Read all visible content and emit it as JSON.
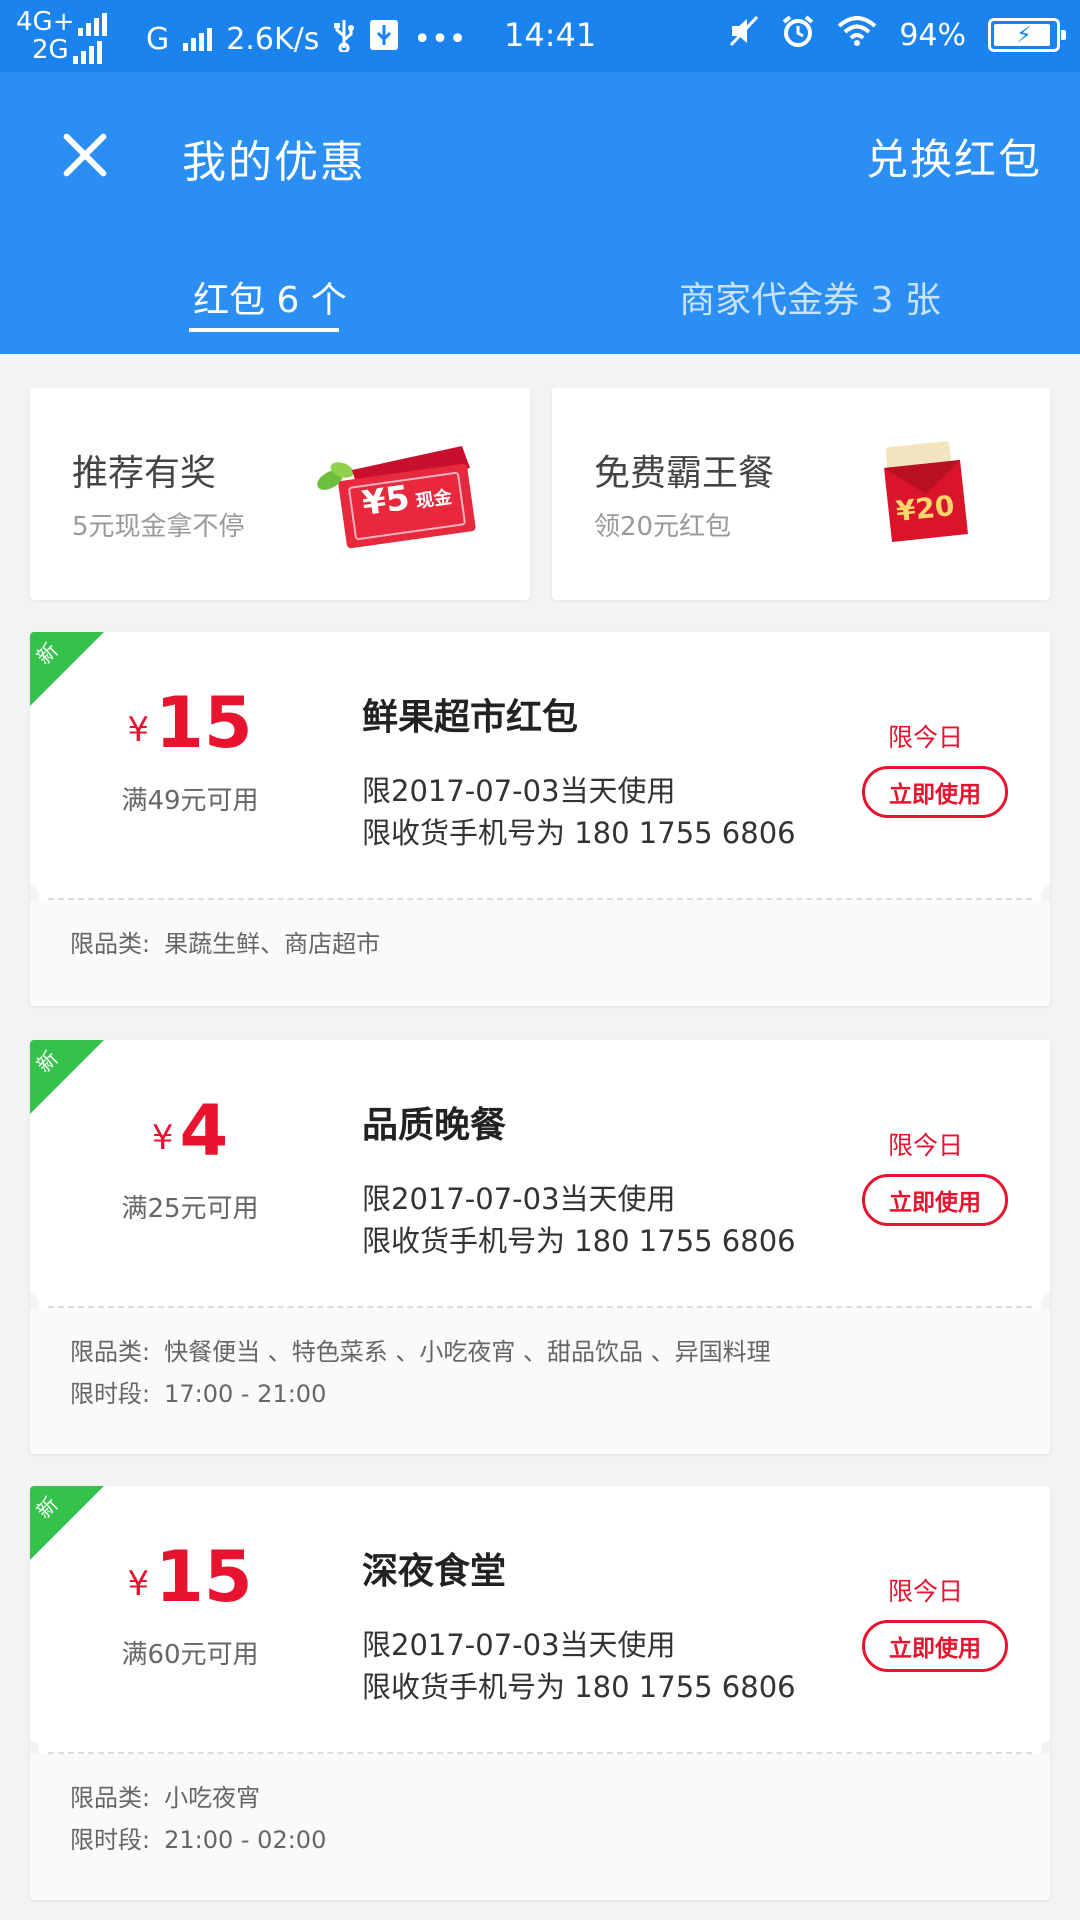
{
  "status_bar": {
    "net_top": "4G+",
    "net_bottom": "2G",
    "carrier": "G",
    "speed": "2.6K/s",
    "time": "14:41",
    "battery": "94%",
    "battery_level": 0.94
  },
  "header": {
    "title": "我的优惠",
    "exchange": "兑换红包"
  },
  "tabs": [
    {
      "label": "红包 6 个",
      "active": true
    },
    {
      "label": "商家代金券 3 张",
      "active": false
    }
  ],
  "promos": [
    {
      "title": "推荐有奖",
      "subtitle": "5元现金拿不停",
      "badge": "¥5",
      "badge_suffix": "现金"
    },
    {
      "title": "免费霸王餐",
      "subtitle": "领20元红包",
      "badge": "¥20"
    }
  ],
  "coupons": [
    {
      "new_tag": "新",
      "currency": "¥",
      "amount": "15",
      "threshold": "满49元可用",
      "title": "鲜果超市红包",
      "date_rule": "限2017-07-03当天使用",
      "phone_rule": "限收货手机号为 180 1755 6806",
      "today_label": "限今日",
      "use_label": "立即使用",
      "meta": [
        {
          "key": "限品类:",
          "value": "果蔬生鲜、商店超市"
        }
      ]
    },
    {
      "new_tag": "新",
      "currency": "¥",
      "amount": "4",
      "threshold": "满25元可用",
      "title": "品质晚餐",
      "date_rule": "限2017-07-03当天使用",
      "phone_rule": "限收货手机号为 180 1755 6806",
      "today_label": "限今日",
      "use_label": "立即使用",
      "meta": [
        {
          "key": "限品类:",
          "value": "快餐便当 、特色菜系 、小吃夜宵 、甜品饮品 、异国料理"
        },
        {
          "key": "限时段:",
          "value": "17:00 - 21:00"
        }
      ]
    },
    {
      "new_tag": "新",
      "currency": "¥",
      "amount": "15",
      "threshold": "满60元可用",
      "title": "深夜食堂",
      "date_rule": "限2017-07-03当天使用",
      "phone_rule": "限收货手机号为 180 1755 6806",
      "today_label": "限今日",
      "use_label": "立即使用",
      "meta": [
        {
          "key": "限品类:",
          "value": "小吃夜宵"
        },
        {
          "key": "限时段:",
          "value": "21:00 - 02:00"
        }
      ]
    }
  ],
  "colors": {
    "primary": "#2a8ef3",
    "status_bar": "#1a83ee",
    "accent_red": "#e8142f",
    "new_tag_green": "#35c24a"
  }
}
